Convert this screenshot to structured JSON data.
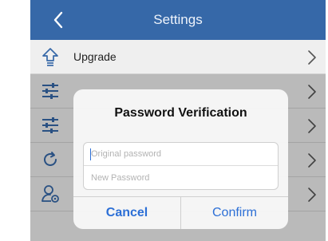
{
  "header": {
    "title": "Settings",
    "back_icon": "chevron-left-icon",
    "color": "#3668a8"
  },
  "rows": [
    {
      "label": "Upgrade",
      "icon": "upgrade-arrow-icon"
    },
    {
      "label": "",
      "icon": "sliders-icon"
    },
    {
      "label": "",
      "icon": "sliders-icon"
    },
    {
      "label": "",
      "icon": "refresh-icon"
    },
    {
      "label": "",
      "icon": "user-settings-icon"
    }
  ],
  "dialog": {
    "title": "Password Verification",
    "original_password_placeholder": "Original password",
    "new_password_placeholder": "New Password",
    "cancel_label": "Cancel",
    "confirm_label": "Confirm",
    "accent_color": "#2c6fd6"
  }
}
